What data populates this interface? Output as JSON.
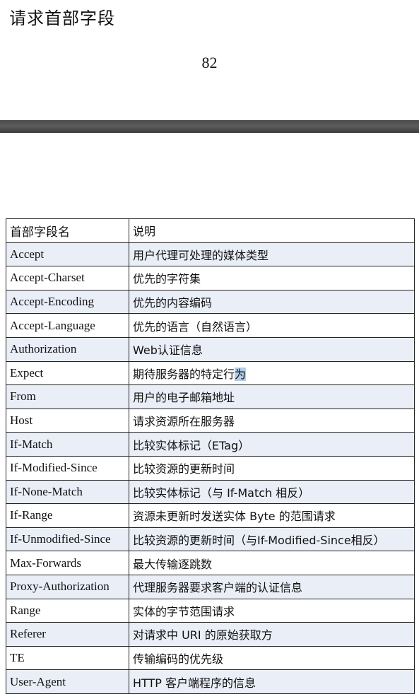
{
  "page": {
    "title": "请求首部字段",
    "page_number": "82"
  },
  "table": {
    "headers": [
      "首部字段名",
      "说明"
    ],
    "rows": [
      {
        "name": "Accept",
        "description": "用户代理可处理的媒体类型"
      },
      {
        "name": "Accept-Charset",
        "description": "优先的字符集"
      },
      {
        "name": "Accept-Encoding",
        "description": "优先的内容编码"
      },
      {
        "name": "Accept-Language",
        "description": "优先的语言（自然语言）"
      },
      {
        "name": "Authorization",
        "description": "Web认证信息"
      },
      {
        "name": "Expect",
        "description": "期待服务器的特定行",
        "selected_text": "为"
      },
      {
        "name": "From",
        "description": "用户的电子邮箱地址"
      },
      {
        "name": "Host",
        "description": "请求资源所在服务器"
      },
      {
        "name": "If-Match",
        "description": "比较实体标记（ETag）"
      },
      {
        "name": "If-Modified-Since",
        "description": "比较资源的更新时间"
      },
      {
        "name": "If-None-Match",
        "description": "比较实体标记（与 If-Match 相反）"
      },
      {
        "name": "If-Range",
        "description": "资源未更新时发送实体 Byte 的范围请求"
      },
      {
        "name": "If-Unmodified-Since",
        "description": "比较资源的更新时间（与If-Modified-Since相反）"
      },
      {
        "name": "Max-Forwards",
        "description": "最大传输逐跳数"
      },
      {
        "name": "Proxy-Authorization",
        "description": "代理服务器要求客户端的认证信息"
      },
      {
        "name": "Range",
        "description": "实体的字节范围请求"
      },
      {
        "name": "Referer",
        "description": "对请求中 URI 的原始获取方"
      },
      {
        "name": "TE",
        "description": "传输编码的优先级"
      },
      {
        "name": "User-Agent",
        "description": "HTTP 客户端程序的信息"
      }
    ]
  },
  "colors": {
    "row_shade": "#e9eef7",
    "border": "#222222",
    "divider": "#4a4a4a",
    "selection": "#b3cde8"
  }
}
